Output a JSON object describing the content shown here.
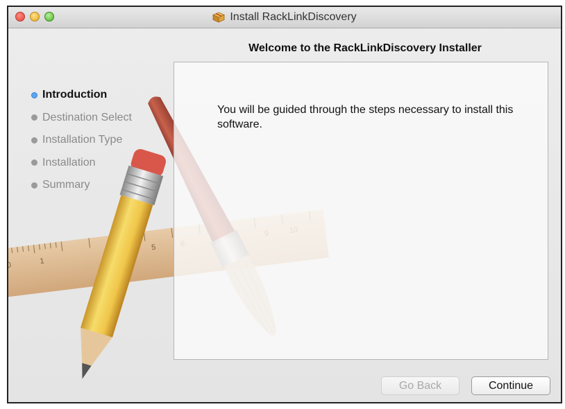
{
  "window": {
    "title": "Install RackLinkDiscovery"
  },
  "header": {
    "welcome": "Welcome to the RackLinkDiscovery Installer"
  },
  "sidebar": {
    "steps": [
      {
        "label": "Introduction",
        "active": true
      },
      {
        "label": "Destination Select",
        "active": false
      },
      {
        "label": "Installation Type",
        "active": false
      },
      {
        "label": "Installation",
        "active": false
      },
      {
        "label": "Summary",
        "active": false
      }
    ]
  },
  "main": {
    "body_text": "You will be guided through the steps necessary to install this software."
  },
  "buttons": {
    "go_back": "Go Back",
    "continue": "Continue"
  },
  "ruler": {
    "numbers": [
      "0",
      "1",
      "4",
      "5",
      "6",
      "9",
      "10"
    ]
  },
  "colors": {
    "active_bullet": "#5aa7f3",
    "inactive_bullet": "#9a9a9a",
    "pencil_body": "#f0c64a",
    "pencil_eraser": "#d9574a",
    "brush_handle": "#a33a2a",
    "ruler_wood": "#d8aa78"
  },
  "icons": {
    "app": "package-icon"
  }
}
